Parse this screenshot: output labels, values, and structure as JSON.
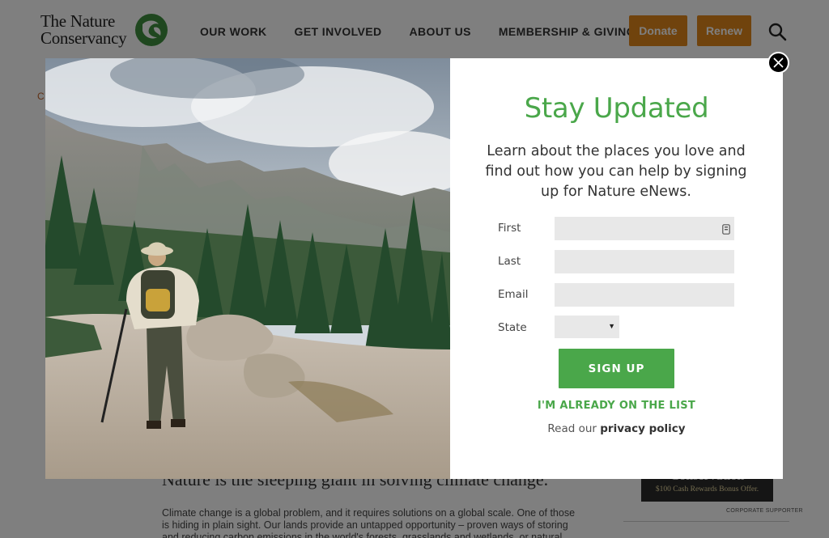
{
  "header": {
    "logo_text_1": "The Nature",
    "logo_text_2": "Conservancy",
    "nav": [
      "OUR WORK",
      "GET INVOLVED",
      "ABOUT US",
      "MEMBERSHIP & GIVING"
    ],
    "donate_label": "Donate",
    "renew_label": "Renew"
  },
  "background_page": {
    "headline": "Nature is the sleeping giant in solving climate change.",
    "body": "Climate change is a global problem, and it requires solutions on a global scale. One of those is hiding in plain sight. Our lands provide an untapped opportunity – proven ways of storing and reducing carbon emissions in the world's forests, grasslands and wetlands, or natural climate",
    "ad_title": "Conservation",
    "ad_subtitle": "$100 Cash Rewards Bonus Offer.",
    "corporate_label": "CORPORATE SUPPORTER"
  },
  "modal": {
    "title": "Stay Updated",
    "description": "Learn about the places you love and find out how you can help by signing up for Nature eNews.",
    "fields": {
      "first_label": "First",
      "last_label": "Last",
      "email_label": "Email",
      "state_label": "State",
      "first_value": "",
      "last_value": "",
      "email_value": "",
      "state_value": ""
    },
    "signup_label": "SIGN UP",
    "already_label": "I'M ALREADY ON THE LIST",
    "privacy_prefix": "Read our ",
    "privacy_link": "privacy policy",
    "close_icon": "close-icon"
  },
  "colors": {
    "accent_green": "#4aa74a",
    "donate_orange": "#e0861a",
    "overlay": "rgba(0,0,0,0.5)"
  }
}
